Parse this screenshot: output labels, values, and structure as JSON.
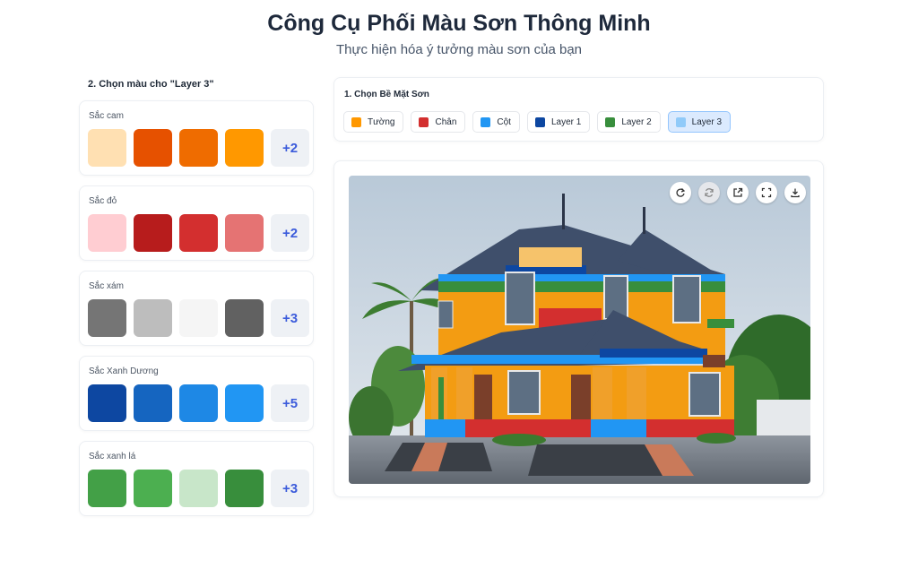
{
  "header": {
    "title": "Công Cụ Phối Màu Sơn Thông Minh",
    "subtitle": "Thực hiện hóa ý tưởng màu sơn của bạn"
  },
  "palette": {
    "heading": "2. Chọn màu cho \"Layer 3\"",
    "groups": [
      {
        "label": "Sắc cam",
        "colors": [
          "#FFE0B2",
          "#E65100",
          "#EF6C00",
          "#FF9800"
        ],
        "more": "+2"
      },
      {
        "label": "Sắc đỏ",
        "colors": [
          "#FFCDD2",
          "#B71C1C",
          "#D32F2F",
          "#E57373"
        ],
        "more": "+2"
      },
      {
        "label": "Sắc xám",
        "colors": [
          "#757575",
          "#BDBDBD",
          "#F5F5F5",
          "#616161"
        ],
        "more": "+3"
      },
      {
        "label": "Sắc Xanh Dương",
        "colors": [
          "#0D47A1",
          "#1565C0",
          "#1E88E5",
          "#2196F3"
        ],
        "more": "+5"
      },
      {
        "label": "Sắc xanh lá",
        "colors": [
          "#43A047",
          "#4CAF50",
          "#C8E6C9",
          "#388E3C"
        ],
        "more": "+3"
      }
    ]
  },
  "surfaces": {
    "heading": "1. Chọn Bề Mặt Sơn",
    "items": [
      {
        "label": "Tường",
        "color": "#FF9800",
        "active": false
      },
      {
        "label": "Chân",
        "color": "#D32F2F",
        "active": false
      },
      {
        "label": "Cột",
        "color": "#2196F3",
        "active": false
      },
      {
        "label": "Layer 1",
        "color": "#0D47A1",
        "active": false
      },
      {
        "label": "Layer 2",
        "color": "#388E3C",
        "active": false
      },
      {
        "label": "Layer 3",
        "color": "#90CAF9",
        "active": true
      }
    ]
  },
  "preview": {
    "tools": [
      {
        "icon": "redo-icon",
        "dim": false
      },
      {
        "icon": "reset-icon",
        "dim": true
      },
      {
        "icon": "open-external-icon",
        "dim": false
      },
      {
        "icon": "fullscreen-icon",
        "dim": false
      },
      {
        "icon": "download-icon",
        "dim": false
      }
    ],
    "colors": {
      "wall": "#F39C12",
      "base": "#D32F2F",
      "column": "#2196F3",
      "layer1": "#0D47A1",
      "layer2": "#388E3C",
      "roof": "#3F4F6B"
    }
  }
}
